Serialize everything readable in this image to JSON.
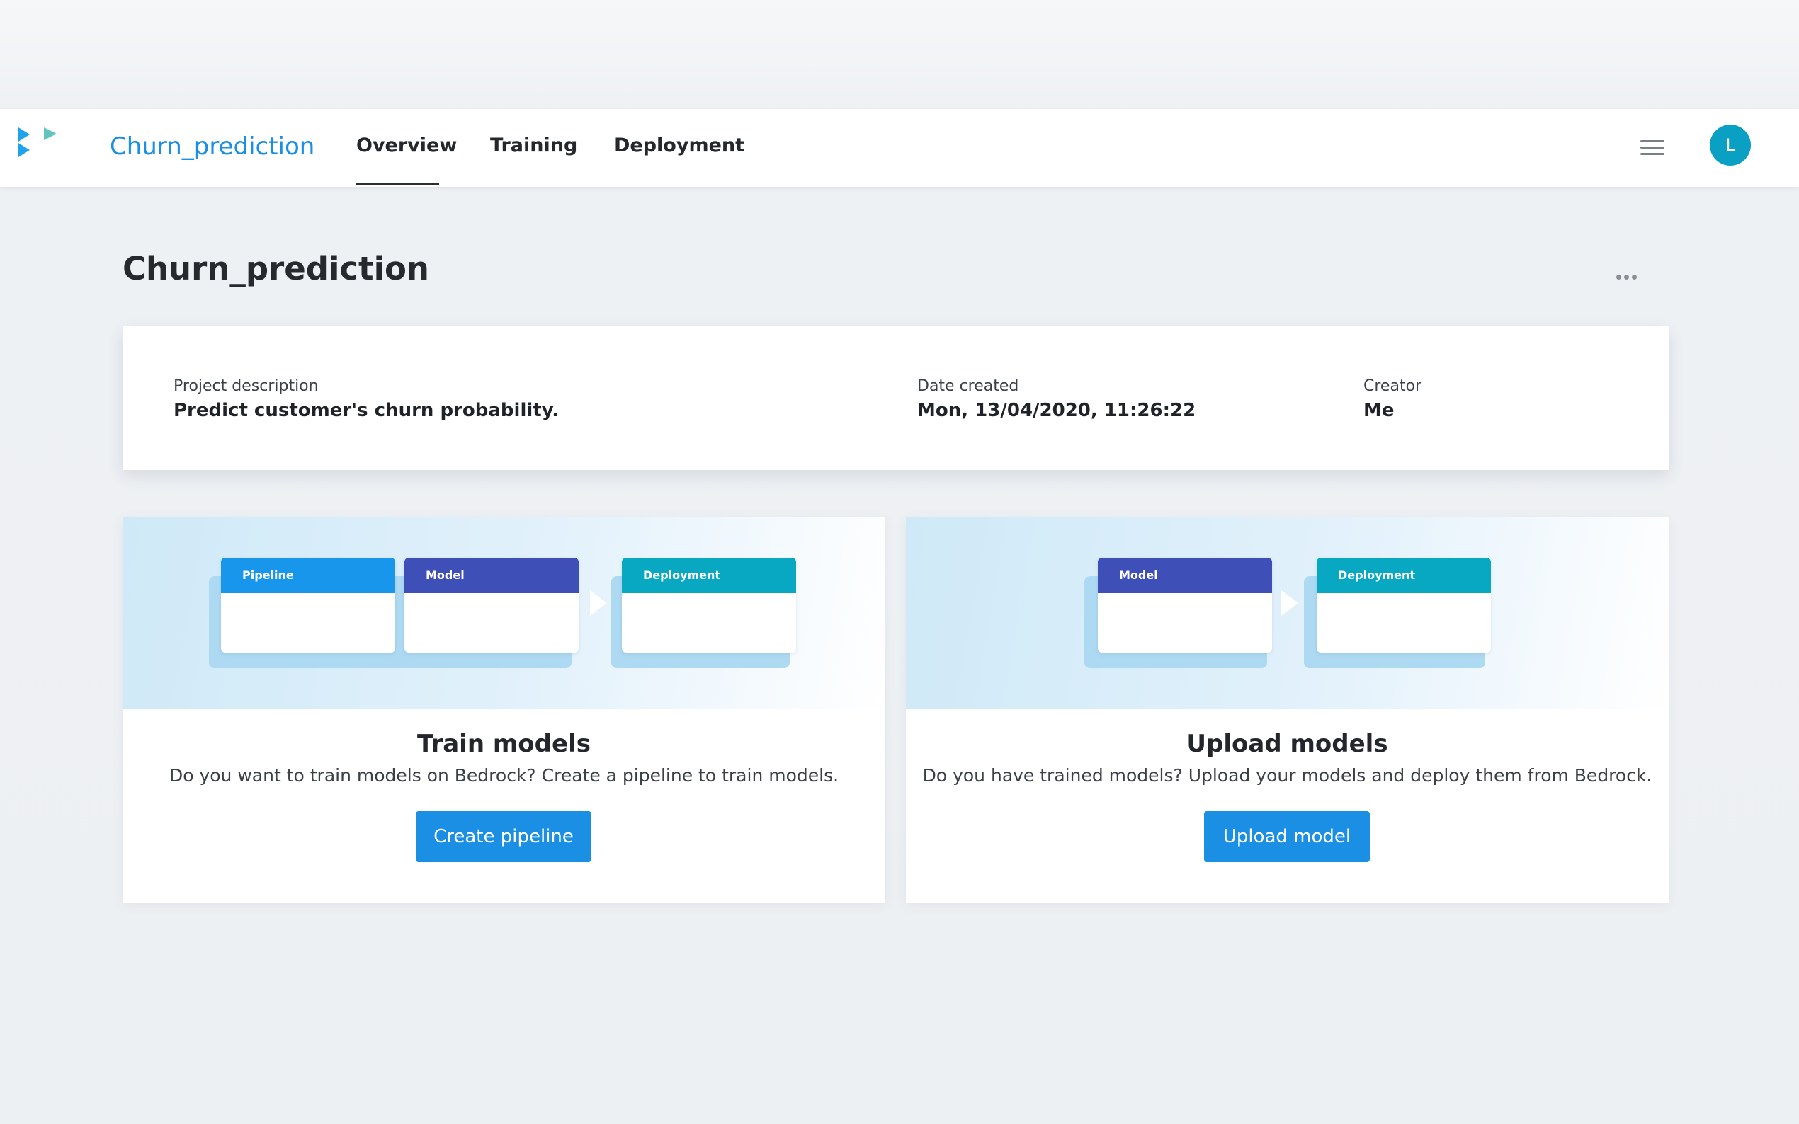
{
  "app": {
    "title": "Churn_prediction",
    "tabs": [
      {
        "label": "Overview",
        "active": true
      },
      {
        "label": "Training",
        "active": false
      },
      {
        "label": "Deployment",
        "active": false
      }
    ],
    "user_initial": "L",
    "brand_color": "#1a8fe3",
    "avatar_color": "#0aa0c4"
  },
  "page": {
    "title": "Churn_prediction"
  },
  "project_info": {
    "description_label": "Project description",
    "description_value": "Predict customer's churn probability.",
    "date_label": "Date created",
    "date_value": "Mon, 13/04/2020, 11:26:22",
    "creator_label": "Creator",
    "creator_value": "Me"
  },
  "train_card": {
    "illustration": [
      "Pipeline",
      "Model",
      "Deployment"
    ],
    "title": "Train models",
    "description": "Do you want to train models on Bedrock? Create a pipeline to train models.",
    "button": "Create pipeline"
  },
  "upload_card": {
    "illustration": [
      "Model",
      "Deployment"
    ],
    "title": "Upload models",
    "description": "Do you have trained models? Upload your models and deploy them from Bedrock.",
    "button": "Upload model"
  },
  "stage_colors": {
    "pipeline": "#1796ec",
    "model": "#3f4fb8",
    "deployment": "#08a8c2"
  }
}
